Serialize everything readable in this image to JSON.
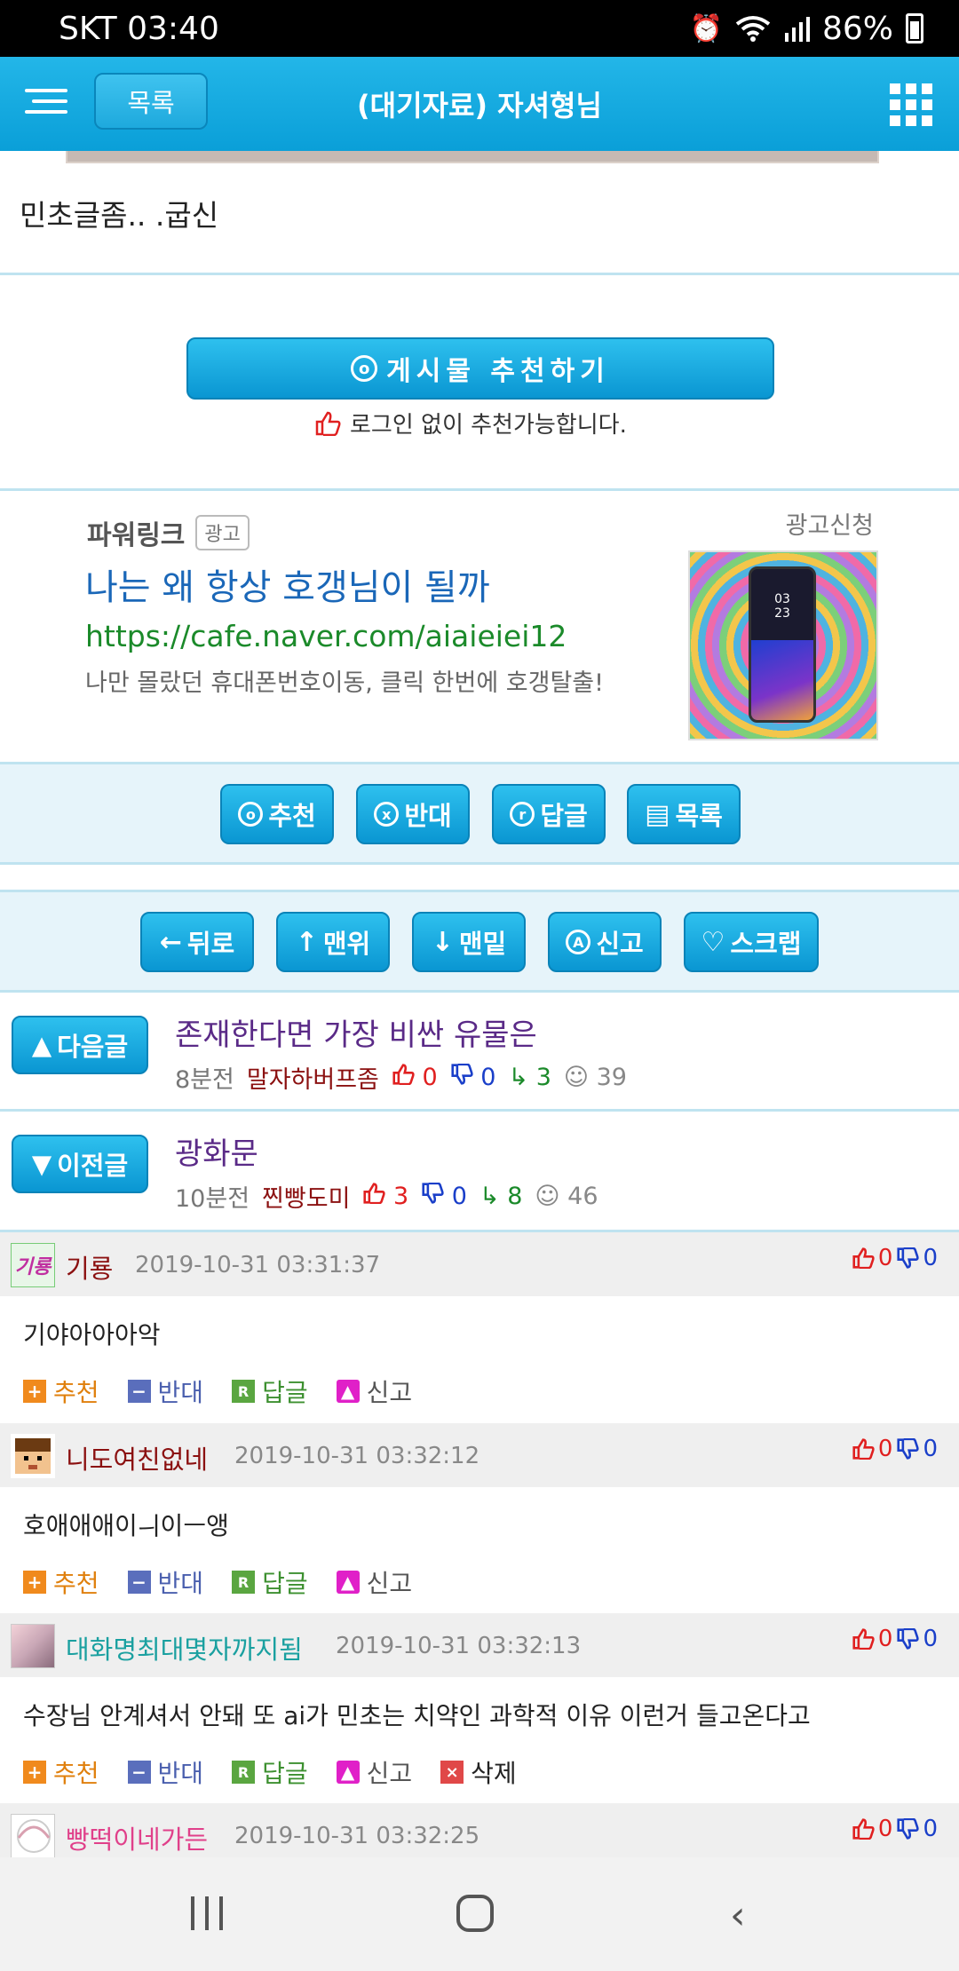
{
  "status_bar": {
    "carrier_time": "SKT 03:40",
    "battery": "86%"
  },
  "header": {
    "list_button": "목록",
    "title": "(대기자료) 자셔형님"
  },
  "post": {
    "text": "민초글좀.. .굽신"
  },
  "recommend": {
    "button_label": "게시물 추천하기",
    "note": "로그인 없이 추천가능합니다."
  },
  "ad": {
    "powerlink": "파워링크",
    "badge": "광고",
    "apply": "광고신청",
    "title": "나는 왜 항상 호갱님이 될까",
    "url": "https://cafe.naver.com/aiaieiei12",
    "desc": "나만 몰랐던 휴대폰번호이동, 클릭 한번에 호갱탈출!",
    "phone_time": "03\n23"
  },
  "actions": {
    "recommend": "추천",
    "oppose": "반대",
    "reply": "답글",
    "list": "목록"
  },
  "nav": {
    "back": "뒤로",
    "top": "맨위",
    "bottom": "맨밑",
    "report": "신고",
    "scrap": "스크랩"
  },
  "next_post": {
    "button": "다음글",
    "title": "존재한다면 가장 비싼 유물은",
    "time": "8분전",
    "author": "말자하버프좀",
    "up": "0",
    "down": "0",
    "replies": "3",
    "views": "39"
  },
  "prev_post": {
    "button": "이전글",
    "title": "광화문",
    "time": "10분전",
    "author": "찐빵도미",
    "up": "3",
    "down": "0",
    "replies": "8",
    "views": "46"
  },
  "comment_labels": {
    "plus": "추천",
    "minus": "반대",
    "reply": "답글",
    "report": "신고",
    "delete": "삭제"
  },
  "comments": [
    {
      "nick": "기룡",
      "avatar_text": "기룡",
      "date": "2019-10-31 03:31:37",
      "up": "0",
      "down": "0",
      "body": "기야아아아악"
    },
    {
      "nick": "니도여친없네",
      "date": "2019-10-31 03:32:12",
      "up": "0",
      "down": "0",
      "body": "호애애애이ㅢ이ㅡ앵"
    },
    {
      "nick": "대화명최대몇자까지됨",
      "date": "2019-10-31 03:32:13",
      "up": "0",
      "down": "0",
      "body": "수장님 안계셔서 안돼 또 ai가 민초는 치약인 과학적 이유 이런거 들고온다고"
    },
    {
      "nick": "빵떡이네가든",
      "date": "2019-10-31 03:32:25",
      "up": "0",
      "down": "0"
    }
  ]
}
